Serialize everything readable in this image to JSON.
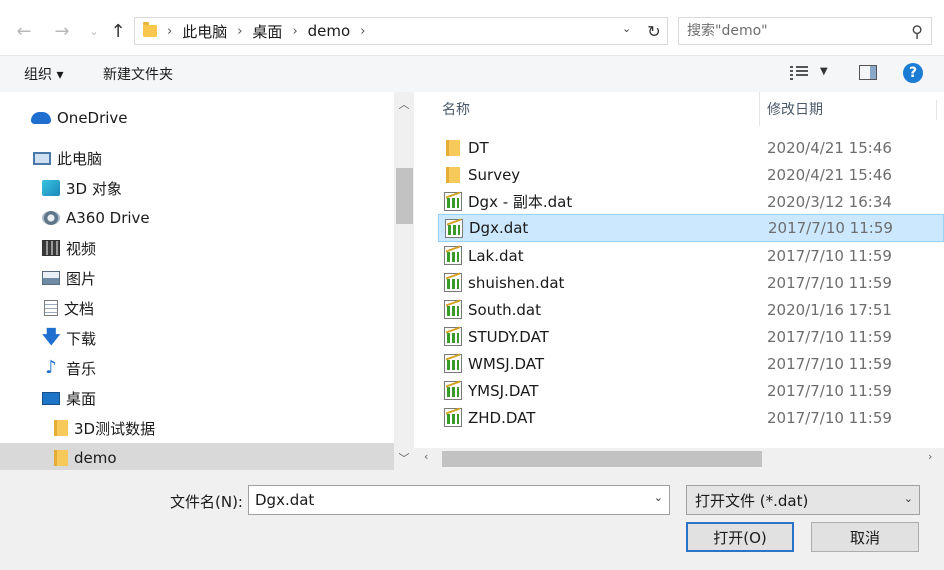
{
  "address": {
    "crumbs": [
      "此电脑",
      "桌面",
      "demo"
    ]
  },
  "search": {
    "placeholder": "搜索\"demo\""
  },
  "toolbar": {
    "organize_label": "组织 ▾",
    "new_folder_label": "新建文件夹"
  },
  "nav": {
    "items": [
      {
        "label": "OneDrive",
        "icon": "onedrive-icon"
      },
      {
        "label": "此电脑",
        "icon": "computer-icon"
      },
      {
        "label": "3D 对象",
        "icon": "3d-objects-icon"
      },
      {
        "label": "A360 Drive",
        "icon": "a360-drive-icon"
      },
      {
        "label": "视频",
        "icon": "video-icon"
      },
      {
        "label": "图片",
        "icon": "pictures-icon"
      },
      {
        "label": "文档",
        "icon": "documents-icon"
      },
      {
        "label": "下载",
        "icon": "download-icon"
      },
      {
        "label": "音乐",
        "icon": "music-icon"
      },
      {
        "label": "桌面",
        "icon": "desktop-icon"
      },
      {
        "label": "3D测试数据",
        "icon": "folder-icon"
      },
      {
        "label": "demo",
        "icon": "folder-icon",
        "selected": true
      }
    ]
  },
  "columns": {
    "name": "名称",
    "modified": "修改日期"
  },
  "files": [
    {
      "name": "DT",
      "date": "2020/4/21 15:46",
      "type": "folder"
    },
    {
      "name": "Survey",
      "date": "2020/4/21 15:46",
      "type": "folder"
    },
    {
      "name": "Dgx - 副本.dat",
      "date": "2020/3/12 16:34",
      "type": "dat"
    },
    {
      "name": "Dgx.dat",
      "date": "2017/7/10 11:59",
      "type": "dat",
      "selected": true
    },
    {
      "name": "Lak.dat",
      "date": "2017/7/10 11:59",
      "type": "dat"
    },
    {
      "name": "shuishen.dat",
      "date": "2017/7/10 11:59",
      "type": "dat"
    },
    {
      "name": "South.dat",
      "date": "2020/1/16 17:51",
      "type": "dat"
    },
    {
      "name": "STUDY.DAT",
      "date": "2017/7/10 11:59",
      "type": "dat"
    },
    {
      "name": "WMSJ.DAT",
      "date": "2017/7/10 11:59",
      "type": "dat"
    },
    {
      "name": "YMSJ.DAT",
      "date": "2017/7/10 11:59",
      "type": "dat"
    },
    {
      "name": "ZHD.DAT",
      "date": "2017/7/10 11:59",
      "type": "dat"
    }
  ],
  "footer": {
    "filename_label": "文件名(N):",
    "filename_value": "Dgx.dat",
    "filter_value": "打开文件 (*.dat)",
    "open_label": "打开(O)",
    "cancel_label": "取消"
  },
  "colors": {
    "selection": "#cce8ff",
    "accent": "#2b73c8",
    "help": "#1c7bd3"
  }
}
